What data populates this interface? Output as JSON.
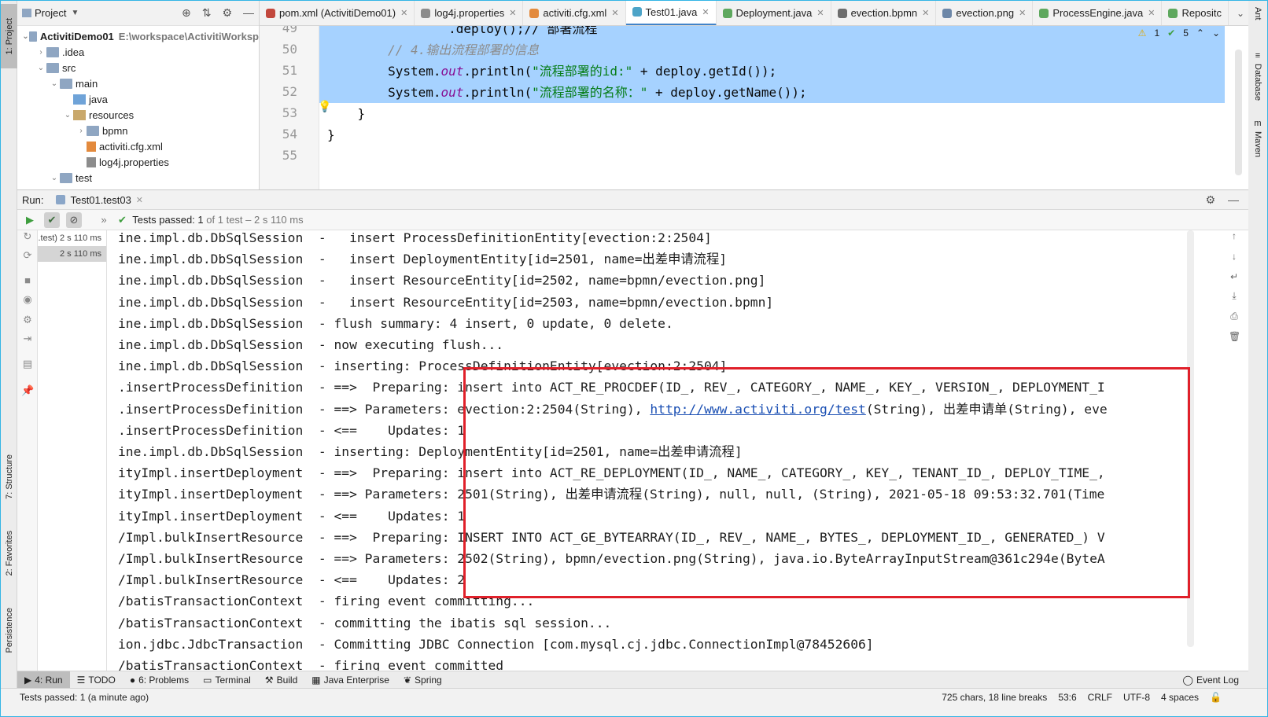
{
  "left_strip": {
    "project_tab": "1: Project",
    "structure_tab": "7: Structure",
    "favorites_tab": "2: Favorites",
    "persistence_tab": "Persistence"
  },
  "right_strip": {
    "ant_tab": "Ant",
    "database_tab": "Database",
    "maven_tab": "Maven"
  },
  "project_panel": {
    "title": "Project",
    "tree": [
      {
        "label": "ActivitiDemo01",
        "path": "E:\\workspace\\ActivitiWorksp",
        "indent": 0,
        "arrow": "⌄",
        "icon": "folder"
      },
      {
        "label": ".idea",
        "indent": 1,
        "arrow": "›",
        "icon": "folder"
      },
      {
        "label": "src",
        "indent": 1,
        "arrow": "⌄",
        "icon": "folder"
      },
      {
        "label": "main",
        "indent": 2,
        "arrow": "⌄",
        "icon": "folder"
      },
      {
        "label": "java",
        "indent": 3,
        "arrow": "",
        "icon": "folder-blue"
      },
      {
        "label": "resources",
        "indent": 3,
        "arrow": "⌄",
        "icon": "folder-res"
      },
      {
        "label": "bpmn",
        "indent": 4,
        "arrow": "›",
        "icon": "folder"
      },
      {
        "label": "activiti.cfg.xml",
        "indent": 4,
        "arrow": "",
        "icon": "file-xml"
      },
      {
        "label": "log4j.properties",
        "indent": 4,
        "arrow": "",
        "icon": "file-prop"
      },
      {
        "label": "test",
        "indent": 2,
        "arrow": "⌄",
        "icon": "folder"
      }
    ]
  },
  "editor_tabs": [
    {
      "label": "pom.xml (ActivitiDemo01)",
      "color": "#c2483d",
      "active": false
    },
    {
      "label": "log4j.properties",
      "color": "#8c8c8c",
      "active": false
    },
    {
      "label": "activiti.cfg.xml",
      "color": "#e38a3d",
      "active": false
    },
    {
      "label": "Test01.java",
      "color": "#4da4c8",
      "active": true
    },
    {
      "label": "Deployment.java",
      "color": "#5ea85e",
      "active": false
    },
    {
      "label": "evection.bpmn",
      "color": "#6d6d6d",
      "active": false
    },
    {
      "label": "evection.png",
      "color": "#6d87a8",
      "active": false
    },
    {
      "label": "ProcessEngine.java",
      "color": "#5ea85e",
      "active": false
    },
    {
      "label": "Repositc",
      "color": "#5ea85e",
      "active": false
    }
  ],
  "editor": {
    "warnings": "1",
    "checks": "5",
    "lines": [
      {
        "num": "49",
        "parts": [
          {
            "t": "                .deploy();// 部署流程",
            "c": "c-plain"
          }
        ],
        "sel": true
      },
      {
        "num": "50",
        "parts": [
          {
            "t": "        // 4.输出流程部署的信息",
            "c": "c-comment"
          }
        ],
        "sel": true
      },
      {
        "num": "51",
        "parts": [
          {
            "t": "        System.",
            "c": "c-plain"
          },
          {
            "t": "out",
            "c": "c-kw"
          },
          {
            "t": ".println(",
            "c": "c-plain"
          },
          {
            "t": "\"流程部署的id:\"",
            "c": "c-str"
          },
          {
            "t": " + deploy.getId());",
            "c": "c-plain"
          }
        ],
        "sel": true
      },
      {
        "num": "52",
        "parts": [
          {
            "t": "        System.",
            "c": "c-plain"
          },
          {
            "t": "out",
            "c": "c-kw"
          },
          {
            "t": ".println(",
            "c": "c-plain"
          },
          {
            "t": "\"流程部署的名称：\"",
            "c": "c-str"
          },
          {
            "t": " + deploy.getName());",
            "c": "c-plain"
          }
        ],
        "sel": true
      },
      {
        "num": "53",
        "parts": [
          {
            "t": "    }",
            "c": "c-plain"
          }
        ],
        "sel": false
      },
      {
        "num": "54",
        "parts": [
          {
            "t": "}",
            "c": "c-plain"
          }
        ],
        "sel": false
      },
      {
        "num": "55",
        "parts": [
          {
            "t": "",
            "c": "c-plain"
          }
        ],
        "sel": false
      }
    ]
  },
  "run_header": {
    "label": "Run:",
    "tab": "Test01.test03"
  },
  "run_toolbar": {
    "status_label": "Tests passed:",
    "passed": "1",
    "rest": "of 1 test – 2 s 110 ms"
  },
  "test_tree": {
    "rows": [
      {
        "label": ".test) 2 s 110 ms",
        "sel": false
      },
      {
        "label": "2 s 110 ms",
        "sel": true
      }
    ]
  },
  "console": {
    "lines": [
      "ine.impl.db.DbSqlSession  -   insert ProcessDefinitionEntity[evection:2:2504]",
      "ine.impl.db.DbSqlSession  -   insert DeploymentEntity[id=2501, name=出差申请流程]",
      "ine.impl.db.DbSqlSession  -   insert ResourceEntity[id=2502, name=bpmn/evection.png]",
      "ine.impl.db.DbSqlSession  -   insert ResourceEntity[id=2503, name=bpmn/evection.bpmn]",
      "ine.impl.db.DbSqlSession  - flush summary: 4 insert, 0 update, 0 delete.",
      "ine.impl.db.DbSqlSession  - now executing flush...",
      "ine.impl.db.DbSqlSession  - inserting: ProcessDefinitionEntity[evection:2:2504]",
      ".insertProcessDefinition  - ==>  Preparing: insert into ACT_RE_PROCDEF(ID_, REV_, CATEGORY_, NAME_, KEY_, VERSION_, DEPLOYMENT_I",
      ".insertProcessDefinition  - ==> Parameters: evection:2:2504(String), ",
      ".insertProcessDefinition  - <==    Updates: 1",
      "ine.impl.db.DbSqlSession  - inserting: DeploymentEntity[id=2501, name=出差申请流程]",
      "ityImpl.insertDeployment  - ==>  Preparing: insert into ACT_RE_DEPLOYMENT(ID_, NAME_, CATEGORY_, KEY_, TENANT_ID_, DEPLOY_TIME_,",
      "ityImpl.insertDeployment  - ==> Parameters: 2501(String), 出差申请流程(String), null, null, (String), 2021-05-18 09:53:32.701(Time",
      "ityImpl.insertDeployment  - <==    Updates: 1",
      "/Impl.bulkInsertResource  - ==>  Preparing: INSERT INTO ACT_GE_BYTEARRAY(ID_, REV_, NAME_, BYTES_, DEPLOYMENT_ID_, GENERATED_) V",
      "/Impl.bulkInsertResource  - ==> Parameters: 2502(String), bpmn/evection.png(String), java.io.ByteArrayInputStream@361c294e(ByteA",
      "/Impl.bulkInsertResource  - <==    Updates: 2",
      "/batisTransactionContext  - firing event committing...",
      "/batisTransactionContext  - committing the ibatis sql session...",
      "ion.jdbc.JdbcTransaction  - Committing JDBC Connection [com.mysql.cj.jdbc.ConnectionImpl@78452606]",
      "/batisTransactionContext  - firing event committed"
    ],
    "link_text": "http://www.activiti.org/test",
    "link_tail": "(String), 出差申请单(String), eve"
  },
  "bottom_tabs": [
    {
      "label": "4: Run",
      "icon": "▶",
      "active": true
    },
    {
      "label": "TODO",
      "icon": "☰",
      "active": false
    },
    {
      "label": "6: Problems",
      "icon": "●",
      "active": false
    },
    {
      "label": "Terminal",
      "icon": "▭",
      "active": false
    },
    {
      "label": "Build",
      "icon": "⚒",
      "active": false
    },
    {
      "label": "Java Enterprise",
      "icon": "▦",
      "active": false
    },
    {
      "label": "Spring",
      "icon": "❦",
      "active": false
    }
  ],
  "event_log": "Event Log",
  "status_bar": {
    "message": "Tests passed: 1 (a minute ago)",
    "chars": "725 chars, 18 line breaks",
    "position": "53:6",
    "line_sep": "CRLF",
    "encoding": "UTF-8",
    "indent": "4 spaces"
  }
}
